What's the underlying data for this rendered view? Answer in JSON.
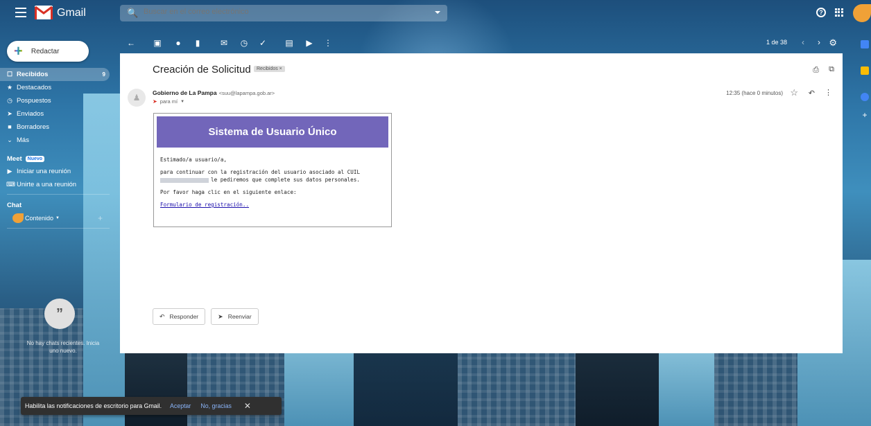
{
  "app": {
    "name": "Gmail"
  },
  "search": {
    "placeholder": "Buscar en el correo electrónico"
  },
  "compose": {
    "label": "Redactar"
  },
  "sidebar": {
    "items": [
      {
        "label": "Recibidos",
        "count": "9",
        "active": true,
        "icon": "inbox-icon"
      },
      {
        "label": "Destacados",
        "count": "",
        "active": false,
        "icon": "star-icon"
      },
      {
        "label": "Pospuestos",
        "count": "",
        "active": false,
        "icon": "clock-icon"
      },
      {
        "label": "Enviados",
        "count": "",
        "active": false,
        "icon": "send-icon"
      },
      {
        "label": "Borradores",
        "count": "",
        "active": false,
        "icon": "draft-icon"
      },
      {
        "label": "Más",
        "count": "",
        "active": false,
        "icon": "chevron-down-icon"
      }
    ],
    "meet": {
      "title": "Meet",
      "badge": "Nuevo",
      "items": [
        {
          "label": "Iniciar una reunión",
          "icon": "video-icon"
        },
        {
          "label": "Unirte a una reunión",
          "icon": "keyboard-icon"
        }
      ]
    },
    "chat": {
      "title": "Chat",
      "user": "Contenido",
      "no_chats": "No hay chats recientes. Inicia uno nuevo."
    }
  },
  "toolbar": {
    "page_counter": "1 de 38"
  },
  "message": {
    "subject": "Creación de Solicitud",
    "label": "Recibidos ×",
    "sender_name": "Gobierno de La Pampa",
    "sender_email": "<suu@lapampa.gob.ar>",
    "to": "para mí",
    "time": "12:35 (hace 0 minutos)",
    "card": {
      "header": "Sistema de Usuario Único",
      "greeting": "Estimado/a usuario/a,",
      "line1": "para continuar con la registración del usuario asociado al CUIL",
      "line2": "le pediremos que complete sus datos personales.",
      "line3": "Por favor haga clic en el siguiente enlace:",
      "link": "Formulario de registración.."
    },
    "reply_label": "Responder",
    "forward_label": "Reenviar"
  },
  "notification": {
    "text": "Habilita las notificaciones de escritorio para Gmail.",
    "accept": "Aceptar",
    "decline": "No, gracias",
    "close": "✕"
  },
  "colors": {
    "card_header": "#7266ba",
    "link": "#1a0dab",
    "notif_action": "#8ab4f8"
  }
}
